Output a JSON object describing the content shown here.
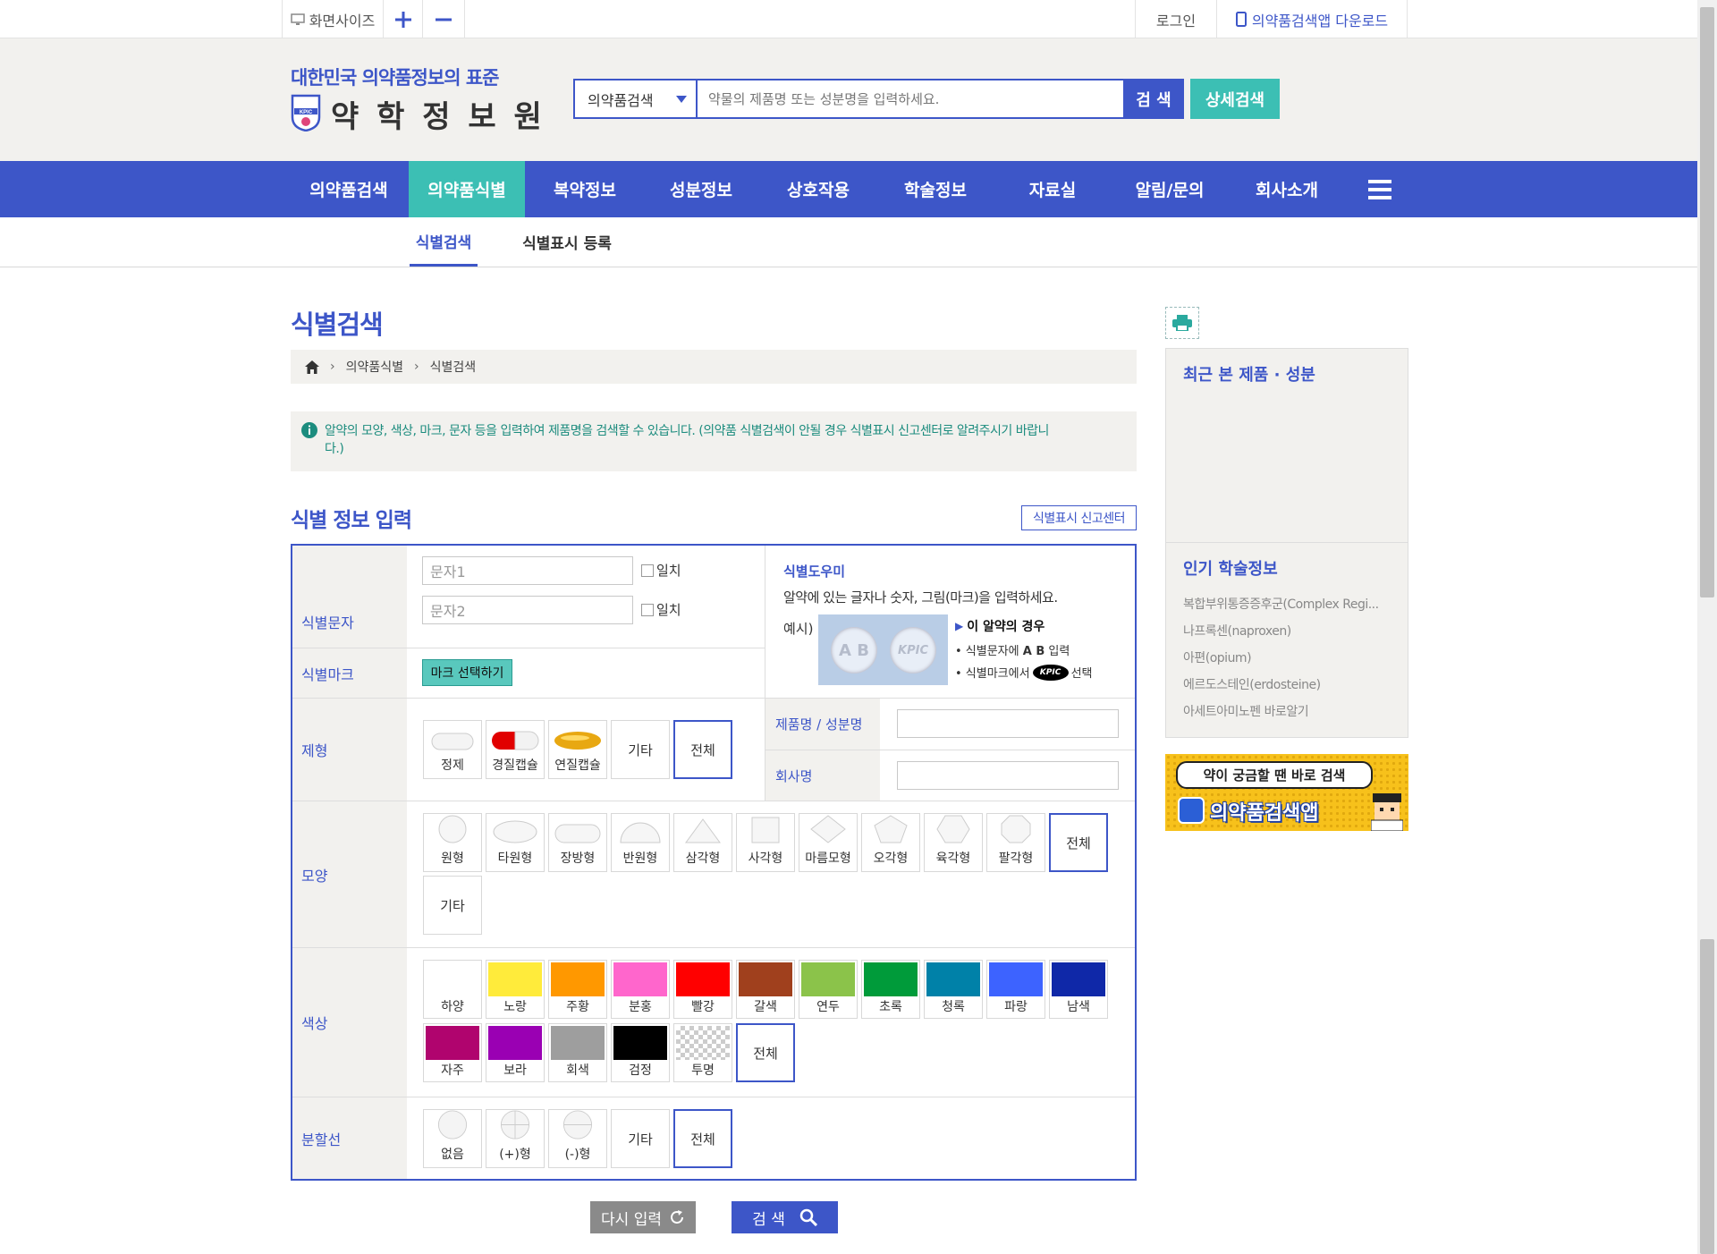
{
  "util": {
    "screen_size": "화면사이즈",
    "login": "로그인",
    "app_download": "의약품검색앱 다운로드"
  },
  "brand": {
    "tagline": "대한민국 의약품정보의 표준",
    "name": "약 학 정 보 원",
    "emblem": "KPIC"
  },
  "search": {
    "category": "의약품검색",
    "placeholder": "약물의 제품명 또는 성분명을 입력하세요.",
    "button": "검 색",
    "detail_button": "상세검색"
  },
  "gnb": [
    "의약품검색",
    "의약품식별",
    "복약정보",
    "성분정보",
    "상호작용",
    "학술정보",
    "자료실",
    "알림/문의",
    "회사소개"
  ],
  "subnav": [
    "식별검색",
    "식별표시 등록"
  ],
  "page": {
    "title": "식별검색",
    "breadcrumb": [
      "의약품식별",
      "식별검색"
    ]
  },
  "notice": {
    "text": "알약의 모양, 색상, 마크, 문자 등을 입력하여 제품명을 검색할 수 있습니다. (의약품 식별검색이 안될 경우 식별표시 신고센터로 알려주시기 바랍니",
    "text2": "다.)"
  },
  "form": {
    "section_title": "식별 정보 입력",
    "report_center": "식별표시 신고센터",
    "labels": {
      "chars": "식별문자",
      "mark": "식별마크",
      "form": "제형",
      "shape": "모양",
      "color": "색상",
      "line": "분할선",
      "product": "제품명 / 성분명",
      "company": "회사명"
    },
    "char1_placeholder": "문자1",
    "char2_placeholder": "문자2",
    "match": "일치",
    "mark_button": "마크 선택하기",
    "helper": {
      "title": "식별도우미",
      "desc": "알약에 있는 글자나 숫자, 그림(마크)을 입력하세요.",
      "example": "예시)",
      "pill_a": "A B",
      "pill_b": "KPIC",
      "case": "이 알약의 경우",
      "step1_pre": "• 식별문자에 ",
      "step1_val": "A B",
      "step1_post": " 입력",
      "step2_pre": "• 식별마크에서 ",
      "step2_mark": "KPIC",
      "step2_post": " 선택"
    },
    "forms": [
      "정제",
      "경질캡슐",
      "연질캡슐",
      "기타",
      "전체"
    ],
    "shapes": [
      "원형",
      "타원형",
      "장방형",
      "반원형",
      "삼각형",
      "사각형",
      "마름모형",
      "오각형",
      "육각형",
      "팔각형",
      "전체",
      "기타"
    ],
    "colors": [
      {
        "name": "하양",
        "hex": "#ffffff"
      },
      {
        "name": "노랑",
        "hex": "#ffeb3b"
      },
      {
        "name": "주황",
        "hex": "#ff9800"
      },
      {
        "name": "분홍",
        "hex": "#ff66cc"
      },
      {
        "name": "빨강",
        "hex": "#ff0000"
      },
      {
        "name": "갈색",
        "hex": "#a0401d"
      },
      {
        "name": "연두",
        "hex": "#8bc34a"
      },
      {
        "name": "초록",
        "hex": "#009b3a"
      },
      {
        "name": "청록",
        "hex": "#0081a8"
      },
      {
        "name": "파랑",
        "hex": "#3d63ff"
      },
      {
        "name": "남색",
        "hex": "#0f28a8"
      },
      {
        "name": "자주",
        "hex": "#b0046e"
      },
      {
        "name": "보라",
        "hex": "#9a00b3"
      },
      {
        "name": "회색",
        "hex": "#9e9e9e"
      },
      {
        "name": "검정",
        "hex": "#000000"
      },
      {
        "name": "투명",
        "hex": "transparent"
      }
    ],
    "color_all": "전체",
    "lines": [
      "없음",
      "(+)형",
      "(-)형",
      "기타",
      "전체"
    ],
    "reset_button": "다시 입력",
    "search_button": "검 색"
  },
  "sidebar": {
    "recent_title": "최근 본 제품 · 성분",
    "popular_title": "인기 학술정보",
    "popular": [
      "복합부위통증증후군(Complex Regi...",
      "나프록센(naproxen)",
      "아편(opium)",
      "에르도스테인(erdosteine)",
      "아세트아미노펜 바로알기"
    ],
    "banner_line1": "약이 궁금할 땐 바로 검색",
    "banner_line2": "의약품검색앱"
  },
  "colors": {
    "primary": "#3d56c8",
    "teal": "#3cbfb4",
    "header_bg": "#f2f1ee"
  }
}
